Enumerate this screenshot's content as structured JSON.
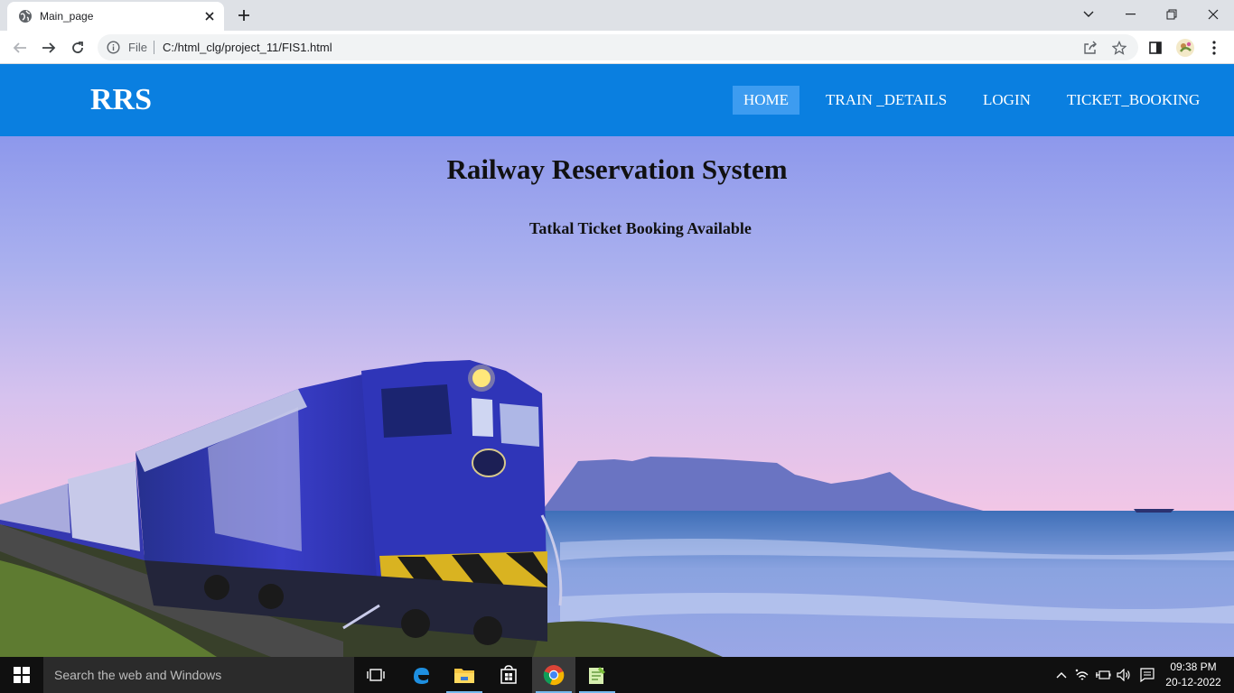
{
  "browser": {
    "tab_title": "Main_page",
    "omnibox_scheme": "File",
    "url": "C:/html_clg/project_11/FIS1.html"
  },
  "site": {
    "brand": "RRS",
    "nav": [
      {
        "label": "HOME",
        "active": true
      },
      {
        "label": "TRAIN _DETAILS",
        "active": false
      },
      {
        "label": "LOGIN",
        "active": false
      },
      {
        "label": "TICKET_BOOKING",
        "active": false
      }
    ],
    "hero_title": "Railway Reservation System",
    "hero_subtitle": "Tatkal Ticket Booking Available"
  },
  "taskbar": {
    "search_placeholder": "Search the web and Windows",
    "time": "09:38 PM",
    "date": "20-12-2022"
  },
  "colors": {
    "navbar": "#0a7fe0",
    "nav_active": "#3d9cf0",
    "train_body": "#3a3ec8"
  }
}
